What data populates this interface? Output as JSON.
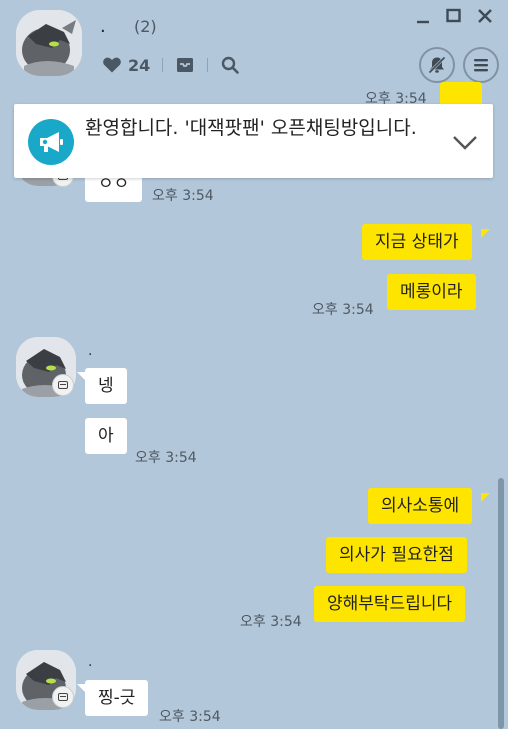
{
  "header": {
    "title": ".",
    "member_count": "(2)",
    "like_count": "24"
  },
  "notice": {
    "text": "환영합니다. '대잭팟팬' 오픈채팅방입니다."
  },
  "messages": [
    {
      "side": "other",
      "text": "ㅇㅇ",
      "time": "오후 3:54"
    },
    {
      "side": "me",
      "text": "지금 상태가"
    },
    {
      "side": "me",
      "text": "메롱이라",
      "time": "오후 3:54"
    },
    {
      "side": "other",
      "sender": ".",
      "text": "넹"
    },
    {
      "side": "other",
      "text": "아",
      "time": "오후 3:54"
    },
    {
      "side": "me",
      "text": "의사소통에"
    },
    {
      "side": "me",
      "text": "의사가 필요한점"
    },
    {
      "side": "me",
      "text": "양해부탁드립니다",
      "time": "오후 3:54"
    },
    {
      "side": "other",
      "sender": ".",
      "text": "찡-긋",
      "time": "오후 3:54"
    }
  ],
  "top_partial": {
    "time": "오후 3:54"
  },
  "colors": {
    "background": "#b2c7d9",
    "my_bubble": "#fee500",
    "other_bubble": "#ffffff",
    "notice_icon": "#19a8c8"
  },
  "icons": {
    "heart": "heart-icon",
    "inbox": "inbox-icon",
    "search": "search-icon",
    "mute": "bell-off-icon",
    "menu": "hamburger-icon",
    "notice": "megaphone-icon",
    "chevron": "chevron-down-icon"
  }
}
